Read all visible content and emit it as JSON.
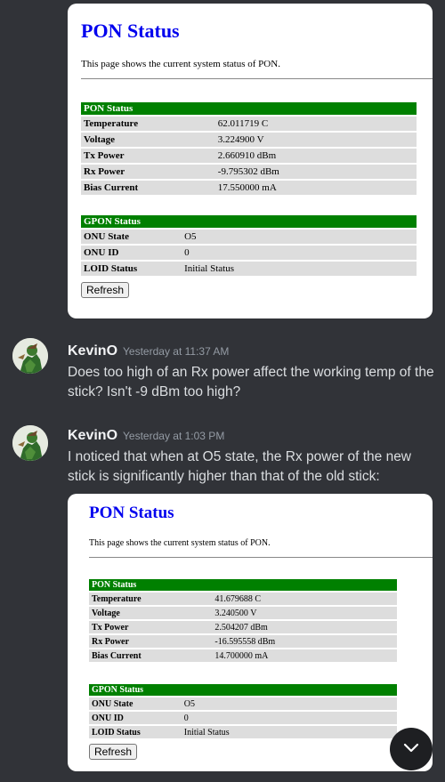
{
  "card1": {
    "heading": "PON Status",
    "description": "This page shows the current system status of PON.",
    "pon_table": {
      "header": "PON Status",
      "rows": [
        {
          "label": "Temperature",
          "value": "62.011719 C"
        },
        {
          "label": "Voltage",
          "value": "3.224900 V"
        },
        {
          "label": "Tx Power",
          "value": "2.660910 dBm"
        },
        {
          "label": "Rx Power",
          "value": "-9.795302 dBm"
        },
        {
          "label": "Bias Current",
          "value": "17.550000 mA"
        }
      ]
    },
    "gpon_table": {
      "header": "GPON Status",
      "rows": [
        {
          "label": "ONU State",
          "value": "O5"
        },
        {
          "label": "ONU ID",
          "value": "0"
        },
        {
          "label": "LOID Status",
          "value": "Initial Status"
        }
      ]
    },
    "refresh_label": "Refresh"
  },
  "messages": [
    {
      "author": "KevinO",
      "timestamp": "Yesterday at 11:37 AM",
      "text": "Does too high of an Rx power affect the working temp of the stick? Isn't -9 dBm too high?"
    },
    {
      "author": "KevinO",
      "timestamp": "Yesterday at 1:03 PM",
      "text": "I noticed that when at O5 state, the Rx power of the new stick is significantly higher than that of the old stick:"
    }
  ],
  "card2": {
    "heading": "PON Status",
    "description": "This page shows the current system status of PON.",
    "pon_table": {
      "header": "PON Status",
      "rows": [
        {
          "label": "Temperature",
          "value": "41.679688 C"
        },
        {
          "label": "Voltage",
          "value": "3.240500 V"
        },
        {
          "label": "Tx Power",
          "value": "2.504207 dBm"
        },
        {
          "label": "Rx Power",
          "value": "-16.595558 dBm"
        },
        {
          "label": "Bias Current",
          "value": "14.700000 mA"
        }
      ]
    },
    "gpon_table": {
      "header": "GPON Status",
      "rows": [
        {
          "label": "ONU State",
          "value": "O5"
        },
        {
          "label": "ONU ID",
          "value": "0"
        },
        {
          "label": "LOID Status",
          "value": "Initial Status"
        }
      ]
    },
    "refresh_label": "Refresh"
  },
  "icons": {
    "avatar": "avatar-icon",
    "scroll_down": "chevron-down-icon"
  },
  "colors": {
    "background": "#313338",
    "table_header": "#008000",
    "heading_link": "#0000ee"
  }
}
